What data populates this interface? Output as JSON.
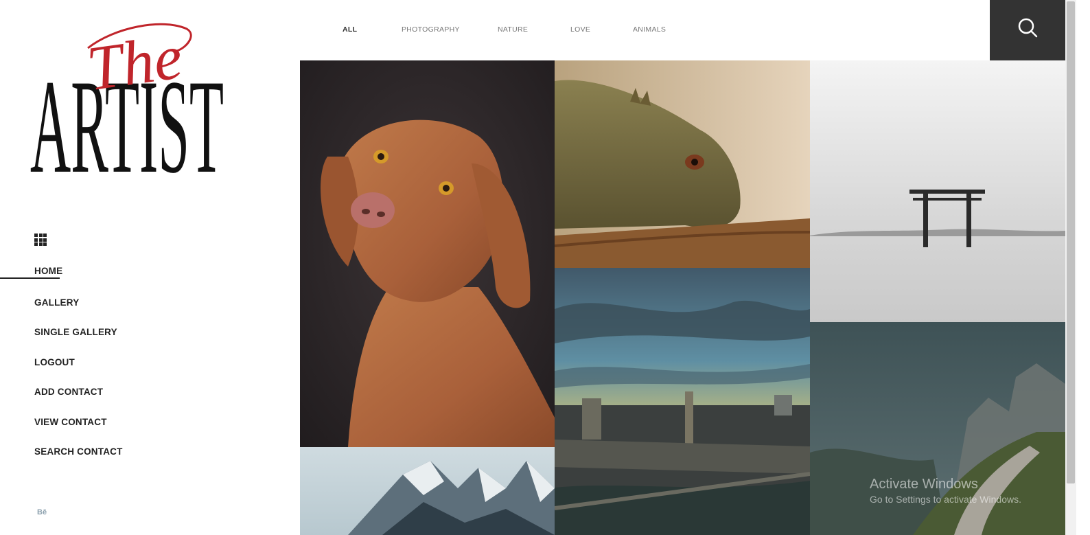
{
  "logo": {
    "script_text": "The",
    "main_text": "ARTIST"
  },
  "sidebar": {
    "items": [
      {
        "label": "HOME",
        "active": true
      },
      {
        "label": "GALLERY"
      },
      {
        "label": "SINGLE GALLERY"
      },
      {
        "label": "LOGOUT"
      },
      {
        "label": "ADD CONTACT"
      },
      {
        "label": "VIEW CONTACT"
      },
      {
        "label": "SEARCH CONTACT"
      }
    ],
    "social": "Bē"
  },
  "filters": [
    {
      "label": "ALL",
      "active": true
    },
    {
      "label": "PHOTOGRAPHY"
    },
    {
      "label": "NATURE"
    },
    {
      "label": "LOVE"
    },
    {
      "label": "ANIMALS"
    }
  ],
  "gallery": [
    {
      "subject": "dog"
    },
    {
      "subject": "iguana"
    },
    {
      "subject": "torii-gate-in-fog"
    },
    {
      "subject": "city-at-sunset"
    },
    {
      "subject": "misty-mountain-path"
    },
    {
      "subject": "snowy-peaks"
    }
  ],
  "watermark": {
    "line1": "Activate Windows",
    "line2": "Go to Settings to activate Windows."
  },
  "colors": {
    "logo_red": "#c0252b",
    "text_dark": "#222222",
    "search_bg": "#333333"
  }
}
